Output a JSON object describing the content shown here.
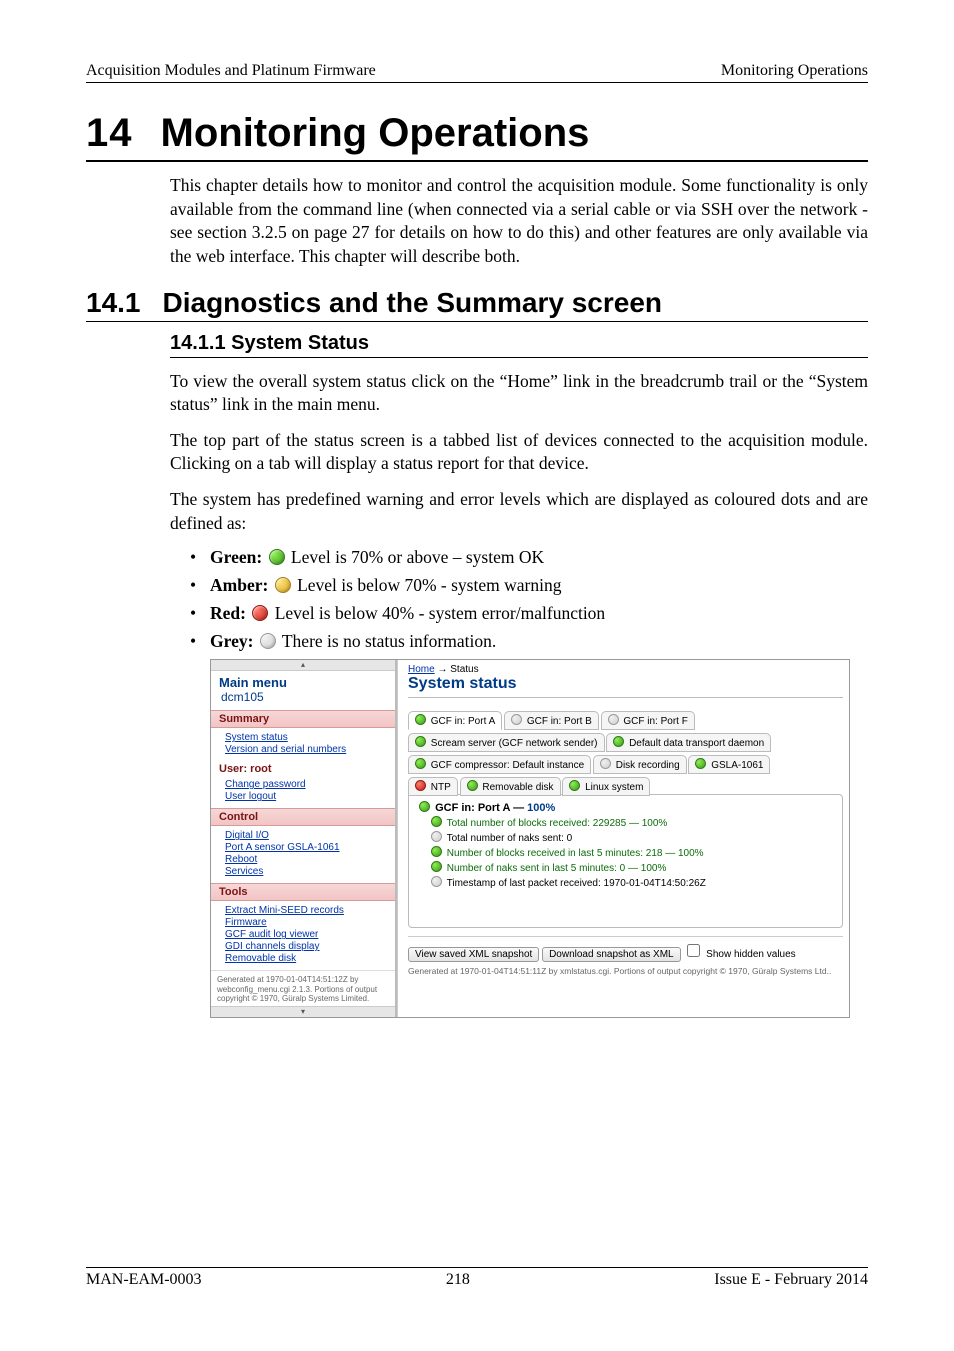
{
  "header": {
    "left": "Acquisition Modules and Platinum Firmware",
    "right": "Monitoring Operations"
  },
  "chapter": {
    "num": "14",
    "title": "Monitoring Operations"
  },
  "intro_para": "This chapter details how to monitor and control the acquisition module. Some functionality is only available from the command line (when connected via a serial cable or via SSH over the network - see section 3.2.5 on page 27 for details on how to do this) and other features are only available via the web interface.  This chapter will describe both.",
  "section": {
    "num": "14.1",
    "title": "Diagnostics and the Summary screen"
  },
  "subsection": {
    "num": "14.1.1",
    "title": "System Status",
    "full": "14.1.1 System Status"
  },
  "para1": "To view the overall system status click on the “Home” link in the breadcrumb trail or the “System status” link in the main menu.",
  "para2": "The top part of the status screen is a tabbed list of devices connected to the acquisition module.  Clicking on a tab will display a status report for that device.",
  "para3": "The system has predefined warning and error levels which are displayed as coloured dots and are defined as:",
  "levels": {
    "green": {
      "label": "Green:",
      "desc": " Level is 70% or above – system OK"
    },
    "amber": {
      "label": "Amber:",
      "desc": " Level is below 70% - system warning"
    },
    "red": {
      "label": "Red:",
      "desc": " Level is below 40% - system error/malfunction"
    },
    "grey": {
      "label": "Grey:",
      "desc": " There is no status information."
    }
  },
  "shot": {
    "menu_title": "Main menu",
    "host": "dcm105",
    "groups": {
      "summary": {
        "heading": "Summary",
        "items": [
          "System status",
          "Version and serial numbers"
        ]
      },
      "user": {
        "heading": "User: root",
        "items": [
          "Change password",
          "User logout"
        ]
      },
      "control": {
        "heading": "Control",
        "items": [
          "Digital I/O",
          "Port A sensor GSLA-1061",
          "Reboot",
          "Services"
        ]
      },
      "tools": {
        "heading": "Tools",
        "items": [
          "Extract Mini-SEED records",
          "Firmware",
          "GCF audit log viewer",
          "GDI channels display",
          "Removable disk"
        ]
      }
    },
    "left_footer": "Generated at 1970-01-04T14:51:12Z by webconfig_menu.cgi 2.1.3. Portions of output copyright © 1970, Güralp Systems Limited.",
    "crumb_home": "Home",
    "crumb_arrow": " → Status",
    "title": "System status",
    "tabs_row1": [
      "GCF in: Port A",
      "GCF in: Port B",
      "GCF in: Port F"
    ],
    "tabs_row2": [
      "Scream server (GCF network sender)",
      "Default data transport daemon"
    ],
    "tabs_row3": [
      "GCF compressor: Default instance",
      "Disk recording",
      "GSLA-1061"
    ],
    "tabs_row4": [
      "NTP",
      "Removable disk",
      "Linux system"
    ],
    "panel_title_prefix": "GCF in: Port A — ",
    "panel_pct": "100%",
    "panel_lines": [
      "Total number of blocks received: 229285 — 100%",
      "Total number of naks sent: 0",
      "Number of blocks received in last 5 minutes: 218 — 100%",
      "Number of naks sent in last 5 minutes: 0 — 100%",
      "Timestamp of last packet received: 1970-01-04T14:50:26Z"
    ],
    "btn_view": "View saved XML snapshot",
    "btn_dl": "Download snapshot as XML",
    "chk_label": "Show hidden values",
    "genline": "Generated at 1970-01-04T14:51:11Z by xmlstatus.cgi. Portions of output copyright © 1970, Güralp Systems Ltd.."
  },
  "footer": {
    "left": "MAN-EAM-0003",
    "center": "218",
    "right": "Issue E  - February 2014"
  }
}
